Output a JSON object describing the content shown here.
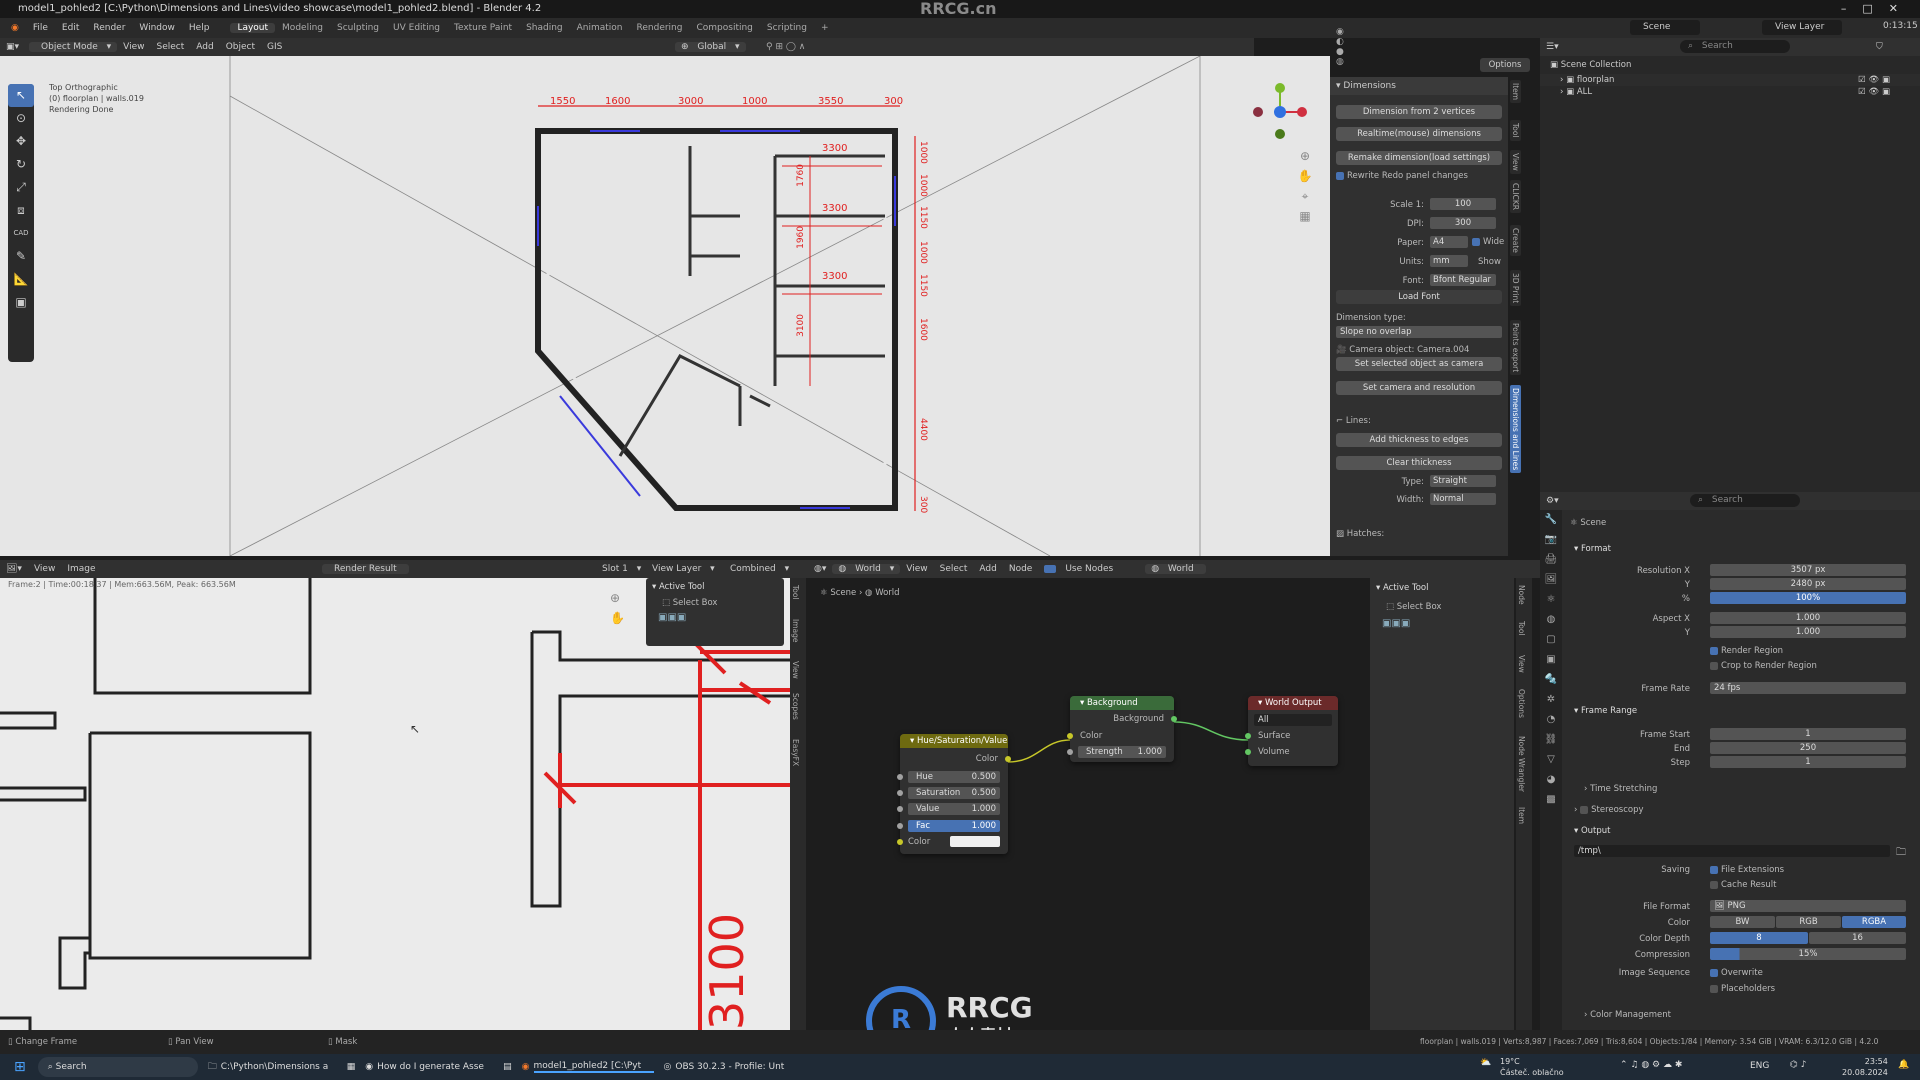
{
  "window": {
    "title": "model1_pohled2 [C:\\Python\\Dimensions and Lines\\video showcase\\model1_pohled2.blend] - Blender 4.2",
    "watermark_top": "RRCG.cn"
  },
  "menu": {
    "items": [
      "File",
      "Edit",
      "Render",
      "Window",
      "Help"
    ],
    "workspaces": [
      "Layout",
      "Modeling",
      "Sculpting",
      "UV Editing",
      "Texture Paint",
      "Shading",
      "Animation",
      "Rendering",
      "Compositing",
      "Scripting"
    ],
    "active_workspace": "Layout",
    "plus": "+"
  },
  "topbar_right": {
    "scene": "Scene",
    "view_layer": "View Layer",
    "time": "0:13:15"
  },
  "viewport": {
    "mode": "Object Mode",
    "menus": [
      "View",
      "Select",
      "Add",
      "Object",
      "GIS"
    ],
    "orientation": "Global",
    "options": "Options",
    "overlay": [
      "Top Orthographic",
      "(0) floorplan | walls.019",
      "Rendering Done"
    ],
    "toolbar_cad": "CAD"
  },
  "dimensions": {
    "top": [
      "1550",
      "1600",
      "3000",
      "1000",
      "3550",
      "300"
    ],
    "inner": [
      "3300",
      "3300",
      "3300"
    ],
    "left_vert": [
      "1760",
      "1960",
      "3100"
    ],
    "right_vert": [
      "1000",
      "1000",
      "1150",
      "1000",
      "1150",
      "1600",
      "4400",
      "300"
    ]
  },
  "npanel": {
    "header": "Dimensions",
    "btn_from2": "Dimension from 2 vertices",
    "btn_realtime": "Realtime(mouse) dimensions",
    "btn_remake": "Remake dimension(load settings)",
    "rewrite": "Rewrite Redo panel changes",
    "scale_label": "Scale 1:",
    "scale": "100",
    "dpi_label": "DPI:",
    "dpi": "300",
    "paper_label": "Paper:",
    "paper": "A4",
    "wide": "Wide",
    "units_label": "Units:",
    "units": "mm",
    "show": "Show",
    "font_label": "Font:",
    "font": "Bfont Regular",
    "load_font": "Load Font",
    "dim_type_label": "Dimension type:",
    "dim_type": "Slope no overlap",
    "camera": "Camera object: Camera.004",
    "set_camera": "Set selected object as camera",
    "set_cam_res": "Set camera and resolution",
    "lines": "Lines:",
    "add_thickness": "Add thickness to edges",
    "clear_thickness": "Clear thickness",
    "type_label": "Type:",
    "type": "Straight",
    "width_label": "Width:",
    "width": "Normal",
    "hatches": "Hatches:",
    "tabs": [
      "Item",
      "Tool",
      "View",
      "CLICKR",
      "Create",
      "3D Print",
      "Points export",
      "Dimensions and Lines"
    ]
  },
  "outliner": {
    "search": "Search",
    "scene_collection": "Scene Collection",
    "items": [
      "floorplan",
      "ALL"
    ]
  },
  "properties": {
    "search": "Search",
    "scene": "Scene",
    "format": "Format",
    "res_x_label": "Resolution X",
    "res_x": "3507 px",
    "res_y_label": "Y",
    "res_y": "2480 px",
    "pct_label": "%",
    "pct": "100%",
    "aspect_x_label": "Aspect X",
    "aspect_x": "1.000",
    "aspect_y_label": "Y",
    "aspect_y": "1.000",
    "render_region": "Render Region",
    "crop_region": "Crop to Render Region",
    "frame_rate_label": "Frame Rate",
    "frame_rate": "24 fps",
    "frame_range": "Frame Range",
    "frame_start_label": "Frame Start",
    "frame_start": "1",
    "end_label": "End",
    "end": "250",
    "step_label": "Step",
    "step": "1",
    "time_stretching": "Time Stretching",
    "stereoscopy": "Stereoscopy",
    "output": "Output",
    "path": "/tmp\\",
    "saving_label": "Saving",
    "file_ext": "File Extensions",
    "cache": "Cache Result",
    "file_format_label": "File Format",
    "file_format": "PNG",
    "color_label": "Color",
    "color_opts": [
      "BW",
      "RGB",
      "RGBA"
    ],
    "depth_label": "Color Depth",
    "depth_opts": [
      "8",
      "16"
    ],
    "compression_label": "Compression",
    "compression": "15%",
    "image_seq_label": "Image Sequence",
    "overwrite": "Overwrite",
    "placeholders": "Placeholders",
    "color_mgmt": "Color Management"
  },
  "image_editor": {
    "menus": [
      "View",
      "Image"
    ],
    "render_result": "Render Result",
    "slot": "Slot 1",
    "view_layer": "View Layer",
    "combined": "Combined",
    "info": "Frame:2 | Time:00:18.37 | Mem:663.56M, Peak: 663.56M",
    "dim_text": "3100",
    "active_tool": "Active Tool",
    "select_box": "Select Box",
    "tabs": [
      "Tool",
      "Image",
      "View",
      "Scopes",
      "EasyFX"
    ]
  },
  "node_editor": {
    "world_dd": "World",
    "menus": [
      "View",
      "Select",
      "Add",
      "Node"
    ],
    "use_nodes": "Use Nodes",
    "world": "World",
    "breadcrumb_scene": "Scene",
    "breadcrumb_world": "World",
    "active_tool": "Active Tool",
    "select_box": "Select Box",
    "tabs": [
      "Node",
      "Tool",
      "View",
      "Options",
      "Node Wrangler",
      "Item"
    ],
    "hsv": {
      "title": "Hue/Saturation/Value",
      "color_out": "Color",
      "hue_label": "Hue",
      "hue": "0.500",
      "sat_label": "Saturation",
      "sat": "0.500",
      "val_label": "Value",
      "val": "1.000",
      "fac_label": "Fac",
      "fac": "1.000",
      "color_in": "Color"
    },
    "bg": {
      "title": "Background",
      "out": "Background",
      "color": "Color",
      "strength_label": "Strength",
      "strength": "1.000"
    },
    "wo": {
      "title": "World Output",
      "target": "All",
      "surface": "Surface",
      "volume": "Volume"
    }
  },
  "status": {
    "change_frame": "Change Frame",
    "pan_view": "Pan View",
    "mask": "Mask",
    "stats": "floorplan | walls.019 | Verts:8,987 | Faces:7,069 | Tris:8,604 | Objects:1/84 | Memory: 3.54 GiB | VRAM: 6.3/12.0 GiB | 4.2.0"
  },
  "logo": {
    "brand": "RRCG",
    "sub": "人人素材"
  },
  "taskbar": {
    "search": "Search",
    "apps": [
      "C:\\Python\\Dimensions a",
      "How do I generate Asse",
      "model1_pohled2 [C:\\Pyt",
      "OBS 30.2.3 - Profile: Unt"
    ],
    "weather_temp": "19°C",
    "weather_desc": "Částeč. oblačno",
    "lang": "ENG",
    "time": "23:54",
    "date": "20.08.2024"
  },
  "colors": {
    "accent": "#4772b3",
    "dim_red": "#e02020",
    "hsv_header": "#6e6a10",
    "bg_header": "#3a6b3a",
    "wo_header": "#6b2a2a"
  }
}
